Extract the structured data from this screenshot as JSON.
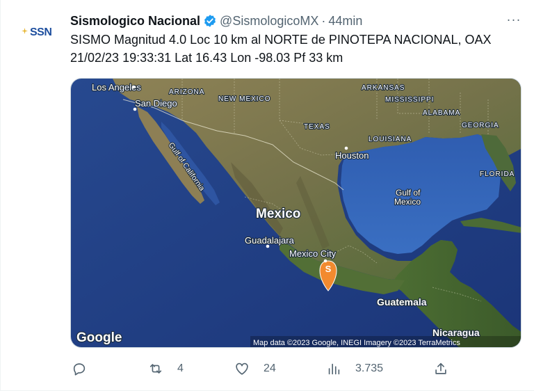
{
  "tweet": {
    "author_name": "Sismologico Nacional",
    "handle": "@SismologicoMX",
    "separator": "·",
    "time": "44min",
    "more_label": "···",
    "avatar_text": "SSN",
    "text_line1": "SISMO Magnitud 4.0 Loc  10 km al NORTE de PINOTEPA NACIONAL, OAX",
    "text_line2": "21/02/23 19:33:31 Lat 16.43 Lon -98.03 Pf 33 km"
  },
  "map": {
    "labels": {
      "los_angeles": "Los Angeles",
      "san_diego": "San Diego",
      "arizona": "ARIZONA",
      "new_mexico": "NEW MEXICO",
      "arkansas": "ARKANSAS",
      "mississippi": "MISSISSIPPI",
      "alabama": "ALABAMA",
      "georgia": "GEORGIA",
      "texas": "TEXAS",
      "louisiana": "LOUISIANA",
      "houston": "Houston",
      "florida": "FLORIDA",
      "gulf_of_california": "Gulf of California",
      "gulf_of_mexico_1": "Gulf of",
      "gulf_of_mexico_2": "Mexico",
      "mexico": "Mexico",
      "guadalajara": "Guadalajara",
      "mexico_city": "Mexico City",
      "guatemala": "Guatemala",
      "nicaragua": "Nicaragua",
      "marker": "S",
      "google": "Google",
      "attribution": "Map data ©2023 Google, INEGI Imagery ©2023 TerraMetrics"
    },
    "colors": {
      "ocean": "#1f3f8a",
      "land": "#7b7a4e",
      "marker": "#f28a2f"
    }
  },
  "actions": {
    "reply_count": "",
    "retweet_count": "4",
    "like_count": "24",
    "views_count": "3.735"
  }
}
